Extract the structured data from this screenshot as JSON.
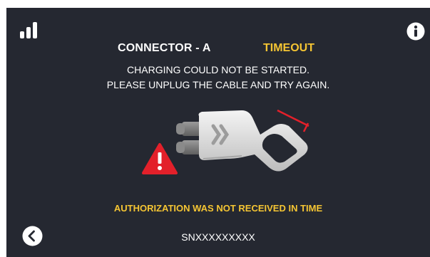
{
  "header": {
    "connector_label": "CONNECTOR - A",
    "status_label": "TIMEOUT"
  },
  "message": {
    "line1": "CHARGING COULD NOT BE STARTED.",
    "line2": "PLEASE UNPLUG THE CABLE AND TRY AGAIN."
  },
  "error": {
    "detail": "AUTHORIZATION WAS NOT RECEIVED IN TIME"
  },
  "footer": {
    "serial_number": "SNXXXXXXXXX"
  },
  "icons": {
    "signal": "signal-strength-icon",
    "info": "info-icon",
    "warning": "warning-icon",
    "plug": "ev-connector-plug-icon",
    "back": "back-chevron-icon"
  },
  "colors": {
    "screen_background": "#252831",
    "accent_yellow": "#f5c533",
    "warning_red": "#e3202a",
    "text_white": "#ffffff"
  }
}
